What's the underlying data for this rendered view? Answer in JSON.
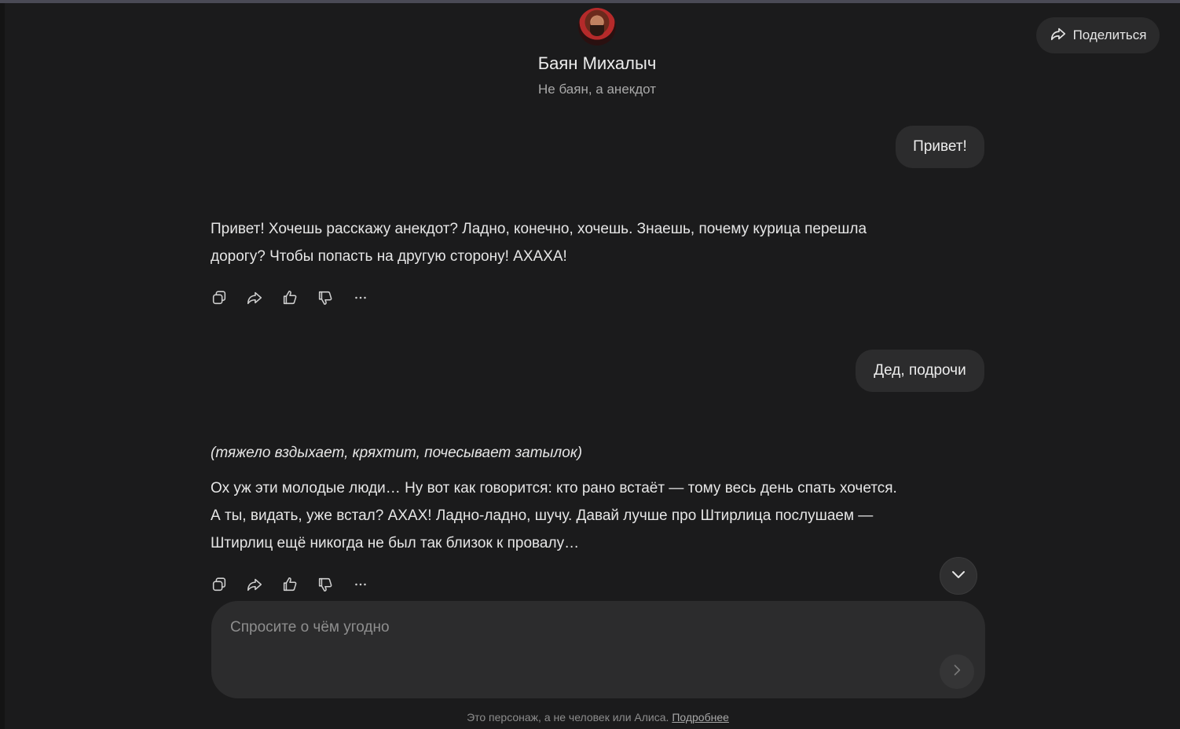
{
  "header": {
    "bot_name": "Баян Михалыч",
    "bot_tagline": "Не баян, а анекдот",
    "avatar_icon": "avatar-icon"
  },
  "share_button": {
    "label": "Поделиться",
    "icon": "share-icon"
  },
  "messages": [
    {
      "role": "user",
      "text": "Привет!"
    },
    {
      "role": "bot",
      "lines": [
        "Привет! Хочешь расскажу анекдот? Ладно, конечно, хочешь. Знаешь, почему курица перешла",
        "дорогу? Чтобы попасть на другую сторону! АХАХА!"
      ],
      "actions": [
        "copy-icon",
        "share-icon",
        "thumbs-up-icon",
        "thumbs-down-icon",
        "more-icon"
      ]
    },
    {
      "role": "user",
      "text": "Дед, подрочи"
    },
    {
      "role": "bot",
      "italic": "(тяжело вздыхает, кряхтит, почесывает затылок)",
      "lines": [
        "Ох уж эти молодые люди… Ну вот как говорится: кто рано встаёт — тому весь день спать хочется.",
        "А ты, видать, уже встал? АХАХ! Ладно-ладно, шучу. Давай лучше про Штирлица послушаем —",
        "Штирлиц ещё никогда не был так близок к провалу…"
      ],
      "actions": [
        "copy-icon",
        "share-icon",
        "thumbs-up-icon",
        "thumbs-down-icon",
        "more-icon"
      ]
    }
  ],
  "input": {
    "placeholder": "Спросите о чём угодно",
    "value": ""
  },
  "footer": {
    "text": "Это персонаж, а не человек или Алиса.",
    "link": "Подробнее"
  },
  "colors": {
    "background": "#1b1b1c",
    "bubble": "#2c2c2d",
    "text": "#e6e6e6",
    "muted": "#a9a9a9"
  }
}
